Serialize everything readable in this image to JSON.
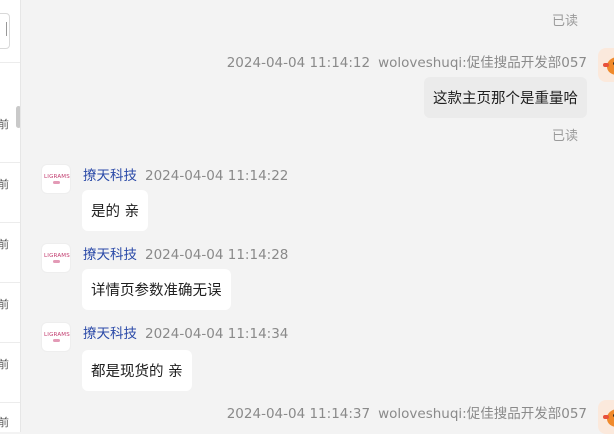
{
  "left_panel": {
    "list_times": [
      "前",
      "前",
      "前",
      "前",
      "前",
      "前"
    ]
  },
  "messages": {
    "read_label": "已读",
    "my_sender": "woloveshuqi:促佳搜品开发部057",
    "shop_name": "撩天科技",
    "shop_logo_text": "LIGRAMS",
    "m0": {
      "timestamp": "2024-04-04 11:14:12",
      "text": "这款主页那个是重量哈"
    },
    "m1": {
      "timestamp": "2024-04-04 11:14:22",
      "text": "是的 亲"
    },
    "m2": {
      "timestamp": "2024-04-04 11:14:28",
      "text": "详情页参数准确无误"
    },
    "m3": {
      "timestamp": "2024-04-04 11:14:34",
      "text": "都是现货的 亲"
    },
    "m4": {
      "timestamp": "2024-04-04 11:14:37"
    }
  }
}
